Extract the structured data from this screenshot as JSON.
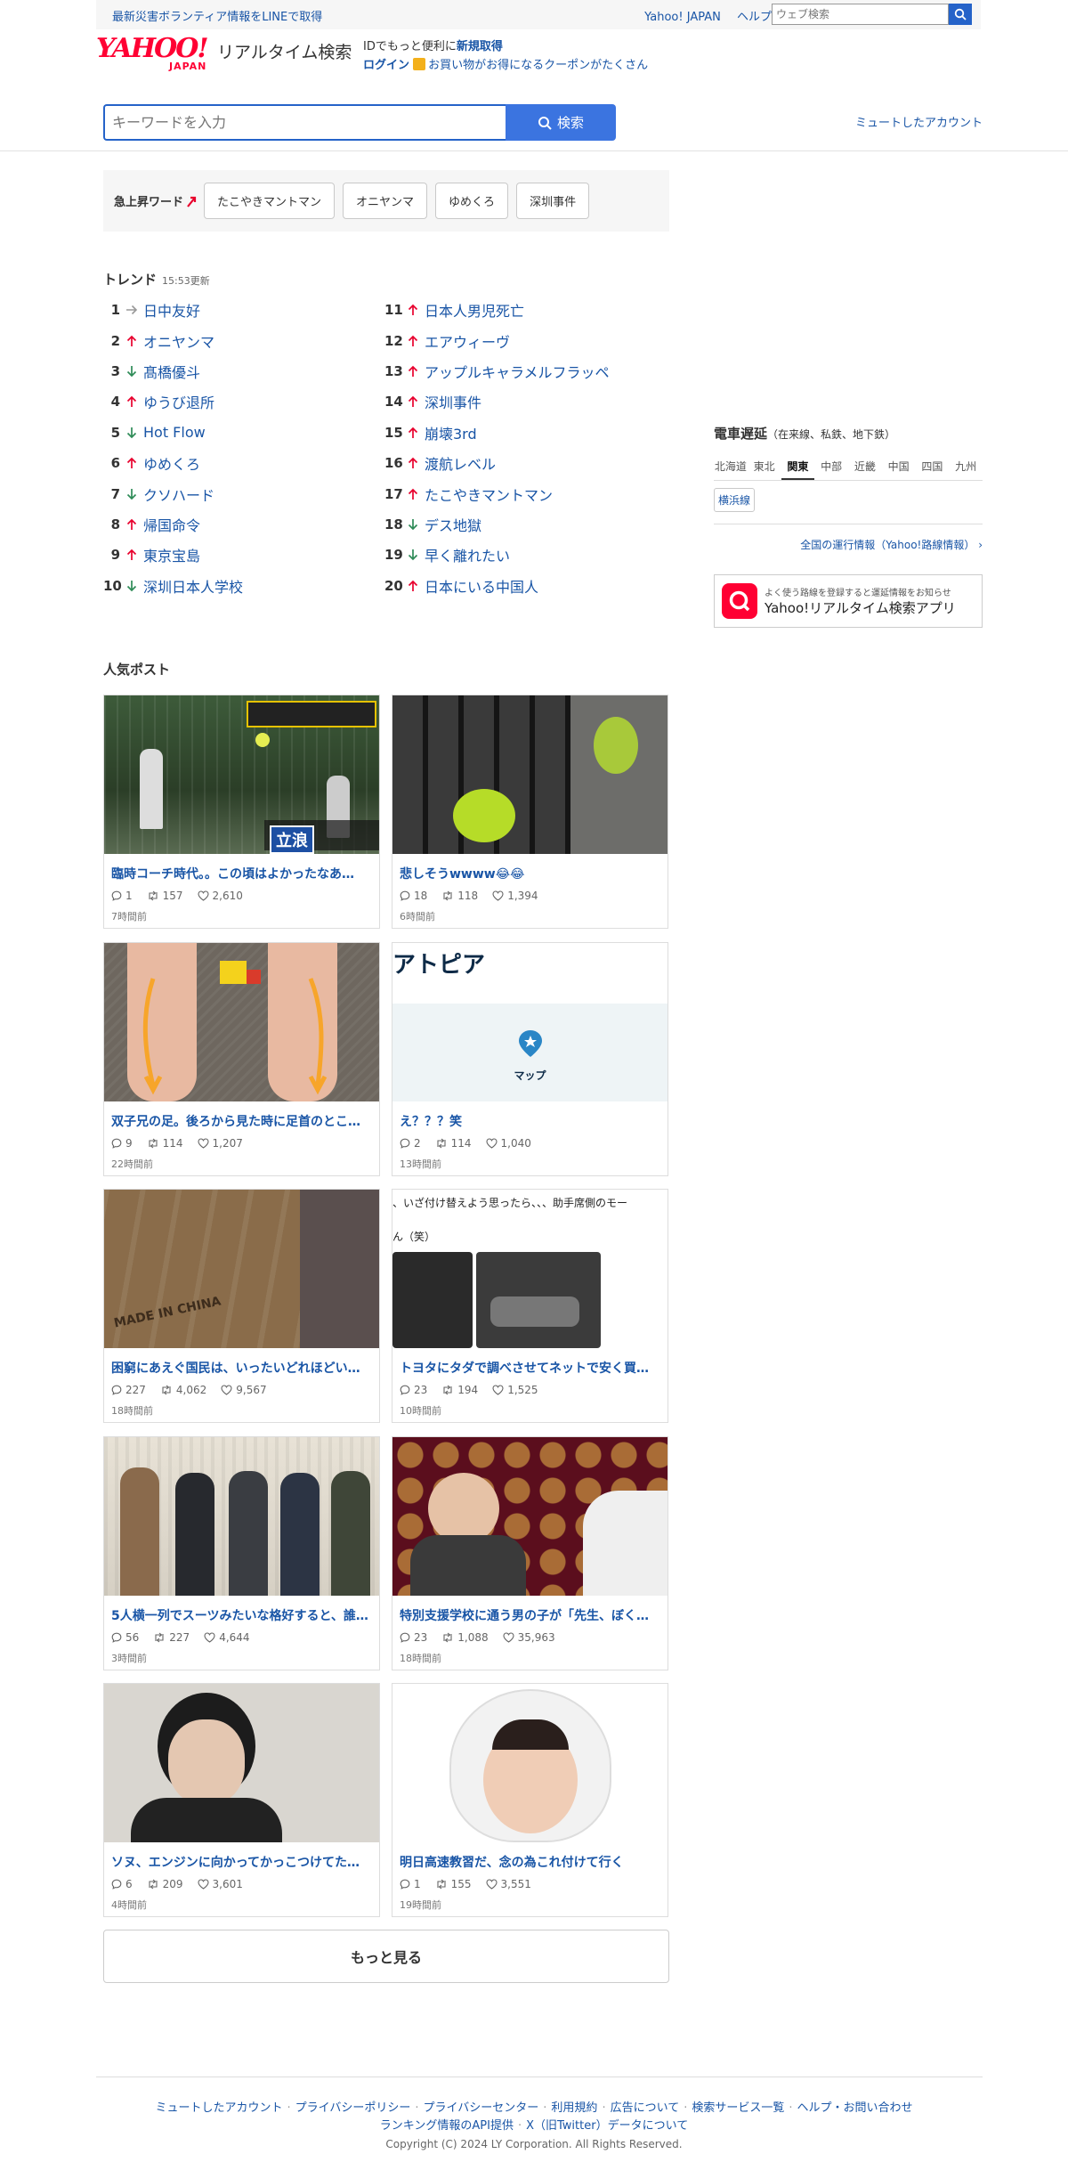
{
  "topbar": {
    "notice": "最新災害ボランティア情報をLINEで取得",
    "links": [
      "Yahoo! JAPAN",
      "ヘルプ"
    ],
    "web_search_placeholder": "ウェブ検索"
  },
  "header": {
    "logo_text": "YAHOO!",
    "logo_sub": "JAPAN",
    "service_name": "リアルタイム検索",
    "id_text": "IDでもっと便利に",
    "register": "新規取得",
    "login": "ログイン",
    "coupon": "お買い物がお得になるクーポンがたくさん"
  },
  "search": {
    "placeholder": "キーワードを入力",
    "button": "検索",
    "muted_accounts": "ミュートしたアカウント"
  },
  "rising": {
    "label": "急上昇ワード",
    "words": [
      "たこやきマントマン",
      "オニヤンマ",
      "ゆめくろ",
      "深圳事件"
    ]
  },
  "trend": {
    "title": "トレンド",
    "updated": "15:53更新",
    "items": [
      {
        "rank": "1",
        "dir": "same",
        "word": "日中友好"
      },
      {
        "rank": "2",
        "dir": "up",
        "word": "オニヤンマ"
      },
      {
        "rank": "3",
        "dir": "down",
        "word": "髙橋優斗"
      },
      {
        "rank": "4",
        "dir": "up",
        "word": "ゆうび退所"
      },
      {
        "rank": "5",
        "dir": "down",
        "word": "Hot Flow"
      },
      {
        "rank": "6",
        "dir": "up",
        "word": "ゆめくろ"
      },
      {
        "rank": "7",
        "dir": "down",
        "word": "クソハード"
      },
      {
        "rank": "8",
        "dir": "up",
        "word": "帰国命令"
      },
      {
        "rank": "9",
        "dir": "up",
        "word": "東京宝島"
      },
      {
        "rank": "10",
        "dir": "down",
        "word": "深圳日本人学校"
      },
      {
        "rank": "11",
        "dir": "up",
        "word": "日本人男児死亡"
      },
      {
        "rank": "12",
        "dir": "up",
        "word": "エアウィーヴ"
      },
      {
        "rank": "13",
        "dir": "up",
        "word": "アップルキャラメルフラッペ"
      },
      {
        "rank": "14",
        "dir": "up",
        "word": "深圳事件"
      },
      {
        "rank": "15",
        "dir": "up",
        "word": "崩壊3rd"
      },
      {
        "rank": "16",
        "dir": "up",
        "word": "渡航レベル"
      },
      {
        "rank": "17",
        "dir": "up",
        "word": "たこやきマントマン"
      },
      {
        "rank": "18",
        "dir": "down",
        "word": "デス地獄"
      },
      {
        "rank": "19",
        "dir": "down",
        "word": "早く離れたい"
      },
      {
        "rank": "20",
        "dir": "up",
        "word": "日本にいる中国人"
      }
    ]
  },
  "train": {
    "title": "電車遅延",
    "subtitle": "（在来線、私鉄、地下鉄）",
    "regions": [
      "北海道",
      "東北",
      "関東",
      "中部",
      "近畿",
      "中国",
      "四国",
      "九州"
    ],
    "active_region": "関東",
    "lines": [
      "横浜線"
    ],
    "all_info": "全国の運行情報（Yahoo!路線情報）"
  },
  "app_banner": {
    "line1": "よく使う路線を登録すると運延情報をお知らせ",
    "line2": "Yahoo!リアルタイム検索アプリ"
  },
  "posts": {
    "title": "人気ポスト",
    "items": [
      {
        "title": "臨時コーチ時代。。この頃はよかったなあ…",
        "replies": "1",
        "reposts": "157",
        "likes": "2,610",
        "time": "7時間前",
        "img": "baseball",
        "caption": "立浪"
      },
      {
        "title": "悲しそうwwww😂😂",
        "replies": "18",
        "reposts": "118",
        "likes": "1,394",
        "time": "6時間前",
        "img": "parakeet",
        "caption": ""
      },
      {
        "title": "双子兄の足。後ろから見た時に足首のとこ…",
        "replies": "9",
        "reposts": "114",
        "likes": "1,207",
        "time": "22時間前",
        "img": "legs",
        "caption": ""
      },
      {
        "title": "え？？？笑",
        "replies": "2",
        "reposts": "114",
        "likes": "1,040",
        "time": "13時間前",
        "img": "map",
        "caption": "アトピア",
        "sub": "マップ"
      },
      {
        "title": "困窮にあえぐ国民は、いったいどれほどい…",
        "replies": "227",
        "reposts": "4,062",
        "likes": "9,567",
        "time": "18時間前",
        "img": "cardboard",
        "caption": "MADE IN CHINA"
      },
      {
        "title": "トヨタにタダで調べさせてネットで安く買…",
        "replies": "23",
        "reposts": "194",
        "likes": "1,525",
        "time": "10時間前",
        "img": "car",
        "caption": "、いざ付け替えよう思ったら、、、助手席側のモー",
        "sub": "ん（笑）"
      },
      {
        "title": "5人横一列でスーツみたいな格好すると、誰…",
        "replies": "56",
        "reposts": "227",
        "likes": "4,644",
        "time": "3時間前",
        "img": "group",
        "caption": ""
      },
      {
        "title": "特別支援学校に通う男の子が「先生、ぼく…",
        "replies": "23",
        "reposts": "1,088",
        "likes": "35,963",
        "time": "18時間前",
        "img": "stage",
        "caption": ""
      },
      {
        "title": "ソヌ、エンジンに向かってかっこつけてた…",
        "replies": "6",
        "reposts": "209",
        "likes": "3,601",
        "time": "4時間前",
        "img": "portrait",
        "caption": ""
      },
      {
        "title": "明日高速教習だ、念の為これ付けて行く",
        "replies": "1",
        "reposts": "155",
        "likes": "3,551",
        "time": "19時間前",
        "img": "helmet",
        "caption": ""
      }
    ],
    "more": "もっと見る"
  },
  "footer": {
    "links": [
      "ミュートしたアカウント",
      "プライバシーポリシー",
      "プライバシーセンター",
      "利用規約",
      "広告について",
      "検索サービス一覧",
      "ヘルプ・お問い合わせ"
    ],
    "links2": [
      "ランキング情報のAPI提供",
      "X（旧Twitter）データについて"
    ],
    "copyright": "Copyright (C) 2024 LY Corporation. All Rights Reserved."
  },
  "colors": {
    "brand_red": "#ff0033",
    "link_blue": "#1955a6",
    "search_blue": "#3b74e0",
    "up_red": "#e8002d",
    "down_green": "#2e8b57"
  }
}
